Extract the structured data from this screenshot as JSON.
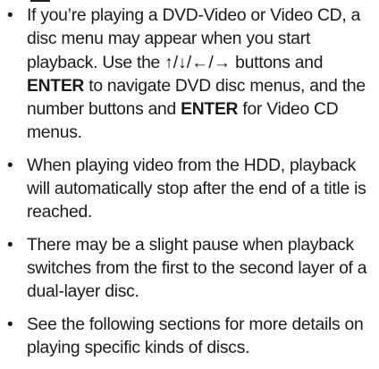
{
  "notes": [
    {
      "segments": [
        {
          "text": "If you’re playing a DVD-Video or Video CD, a disc menu may appear when you start playback. Use the "
        },
        {
          "text": "↑/↓/←/→",
          "style": "arrows"
        },
        {
          "text": " buttons and "
        },
        {
          "text": "ENTER",
          "style": "bold"
        },
        {
          "text": " to navigate DVD disc menus, and the number buttons and "
        },
        {
          "text": "ENTER",
          "style": "bold"
        },
        {
          "text": " for Video CD menus."
        }
      ]
    },
    {
      "segments": [
        {
          "text": "When playing video from the HDD, playback will automatically stop after the end of a title is reached."
        }
      ]
    },
    {
      "segments": [
        {
          "text": "There may be a slight pause when playback switches from the first to the second layer of a dual-layer disc."
        }
      ]
    },
    {
      "segments": [
        {
          "text": "See the following sections for more details on playing specific kinds of discs."
        }
      ]
    }
  ],
  "bullet_char": "•"
}
